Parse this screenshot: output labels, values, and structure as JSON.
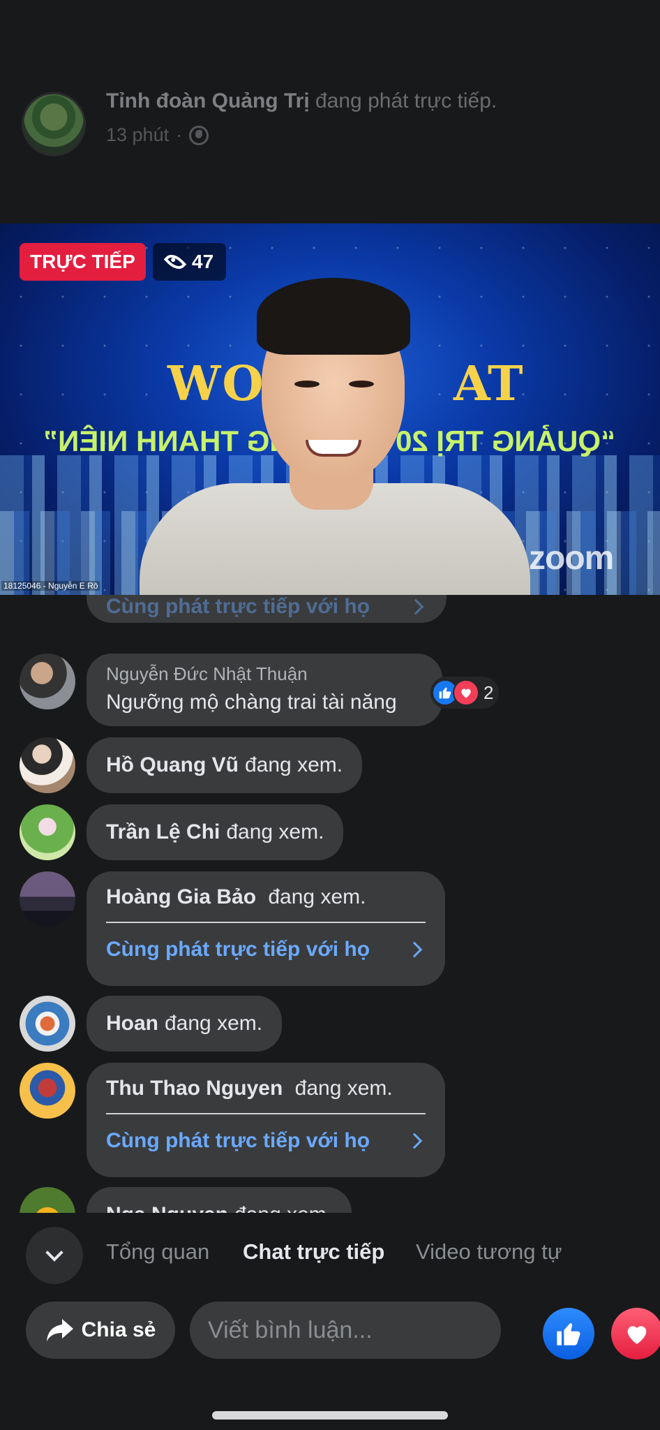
{
  "header": {
    "page_name": "Tỉnh đoàn Quảng Trị",
    "status": "đang phát trực tiếp.",
    "time": "13 phút",
    "separator": "·"
  },
  "video": {
    "live_label": "TRỰC TIẾP",
    "viewer_count": "47",
    "title_left": "WO",
    "title_right": "AT",
    "banner_left": "“QUẢNG TRỊ 20",
    "banner_right": "VỌNG THANH NIÊN”",
    "watermark": "zoom",
    "participant_caption": "18125046 - Nguyễn E Rô"
  },
  "chat": {
    "partial_top_link": "Cùng phát trực tiếp với họ",
    "comment": {
      "author": "Nguyễn Đức Nhật Thuận",
      "text": "Ngưỡng mộ chàng trai tài năng",
      "reaction_count": "2"
    },
    "viewers": [
      {
        "name": "Hồ Quang Vũ",
        "status": "đang xem."
      },
      {
        "name": "Trần Lệ Chi",
        "status": "đang xem."
      },
      {
        "name": "Hoàng Gia Bảo",
        "status": "đang xem.",
        "cohost": "Cùng phát trực tiếp với họ"
      },
      {
        "name": "Hoan",
        "status": "đang xem."
      },
      {
        "name": "Thu Thao Nguyen",
        "status": "đang xem.",
        "cohost": "Cùng phát trực tiếp với họ"
      },
      {
        "name": "Nga Nguyen",
        "status": "đang xem."
      }
    ]
  },
  "tabs": {
    "items": [
      "Tổng quan",
      "Chat trực tiếp",
      "Video tương tự"
    ],
    "active_index": 1
  },
  "bottom": {
    "share_label": "Chia sẻ",
    "comment_placeholder": "Viết bình luận..."
  },
  "colors": {
    "background": "#18191a",
    "bubble": "#3a3b3c",
    "live_red": "#e41e3f",
    "link_blue": "#6aa9ff",
    "like_blue": "#1877f2"
  }
}
